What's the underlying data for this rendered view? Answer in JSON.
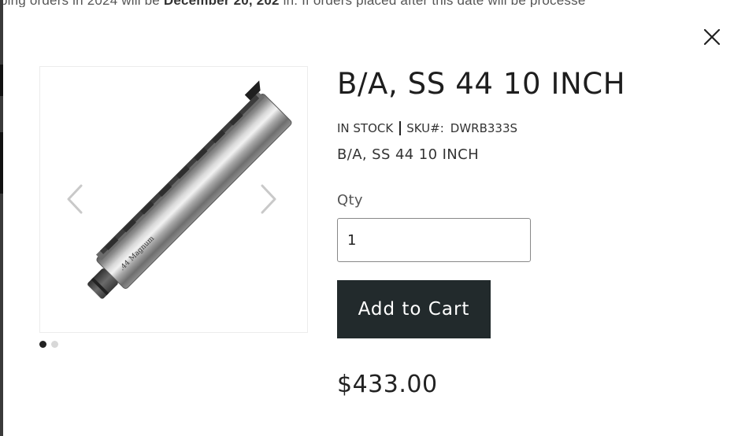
{
  "background": {
    "banner_pre": "ping orders in 2024 will be ",
    "banner_bold": "December 20, 202",
    "banner_post": " in. If orders placed after this date will be processe"
  },
  "modal": {
    "close_icon": "close-icon",
    "gallery": {
      "image_alt": "B/A, SS 44 10 INCH barrel",
      "barrel_engraving": ".44 Magnum",
      "prev_icon": "chevron-left-icon",
      "next_icon": "chevron-right-icon",
      "dots": [
        {
          "active": true
        },
        {
          "active": false
        }
      ]
    },
    "product": {
      "title": "B/A, SS 44 10 INCH",
      "stock_status": "IN STOCK",
      "sku_label": "SKU#:",
      "sku_value": "DWRB333S",
      "subtitle": "B/A, SS 44 10 INCH",
      "qty_label": "Qty",
      "qty_value": "1",
      "add_to_cart_label": "Add to Cart",
      "price": "$433.00"
    }
  },
  "colors": {
    "button_bg": "#222a2c",
    "button_text": "#ffffff",
    "text_primary": "#1e1e1e",
    "dot_active": "#222222",
    "dot_inactive": "#d8d8d8"
  }
}
